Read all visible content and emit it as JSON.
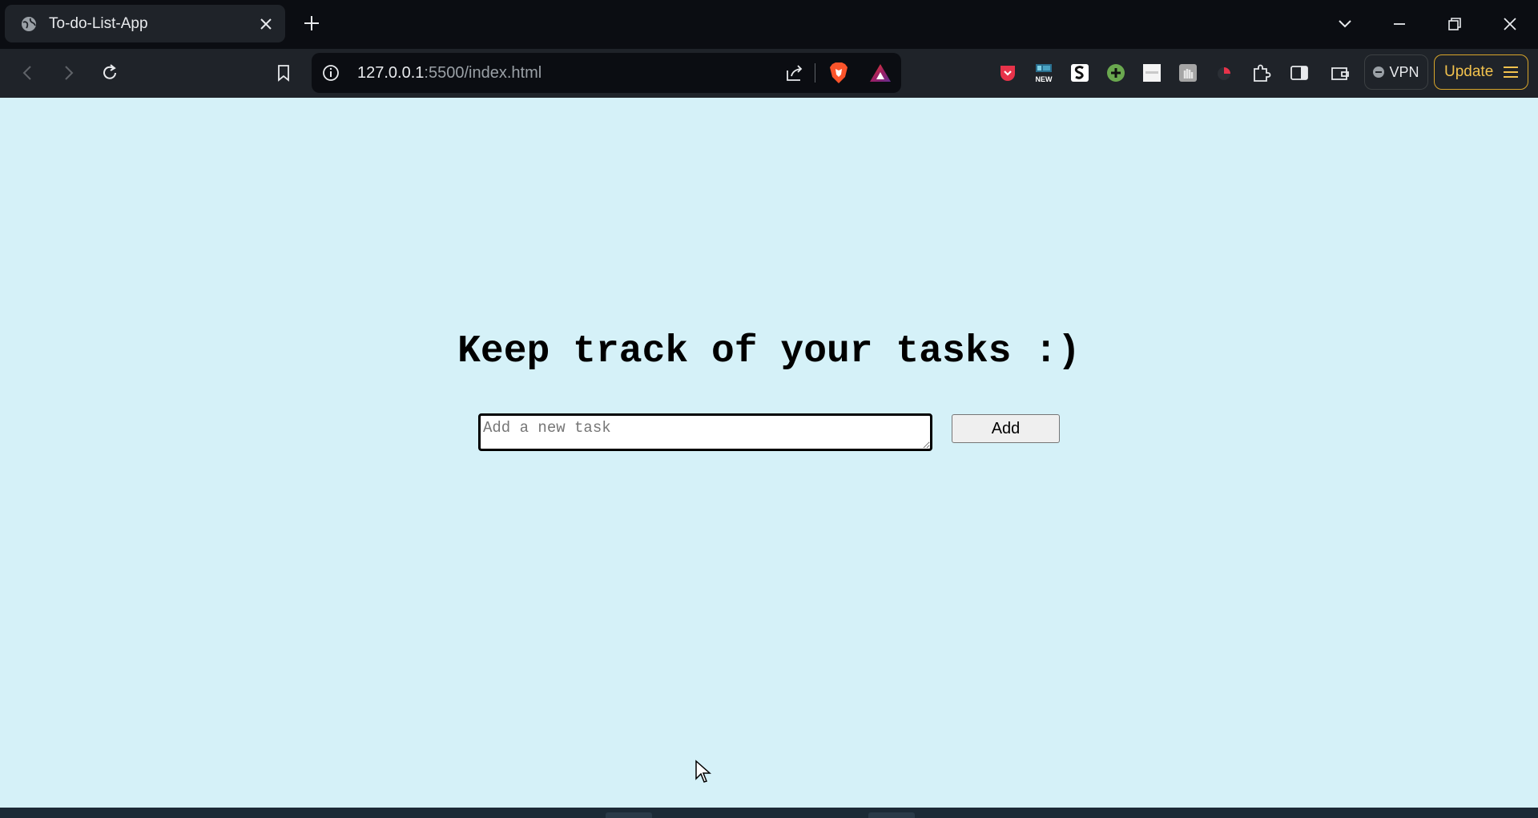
{
  "browser": {
    "tab": {
      "title": "To-do-List-App"
    },
    "url": {
      "host": "127.0.0.1",
      "rest": ":5500/index.html"
    },
    "vpn_label": "VPN",
    "update_label": "Update",
    "accent_update": "#f2c24d",
    "extension_new_badge": "NEW"
  },
  "page": {
    "heading": "Keep track of your tasks :)",
    "task_input": {
      "placeholder": "Add a new task",
      "value": ""
    },
    "add_button_label": "Add",
    "background": "#d5f1f8"
  }
}
